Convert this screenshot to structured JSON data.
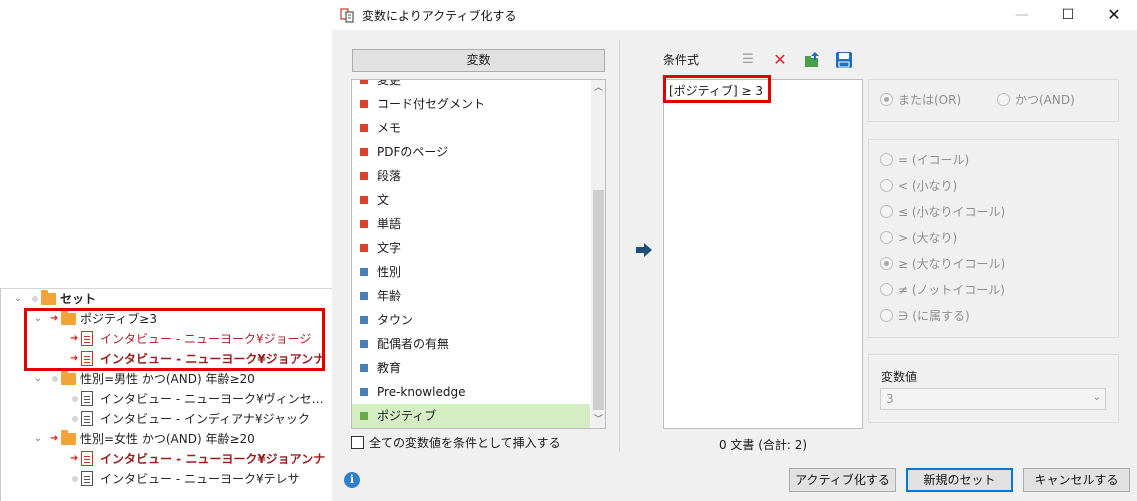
{
  "tree": {
    "root_label": "セット",
    "nodes": [
      {
        "label": "ポジティブ≥3"
      },
      {
        "label": "インタビュー - ニューヨーク¥ジョージ"
      },
      {
        "label": "インタビュー - ニューヨーク¥ジョアンナ"
      },
      {
        "label": "性別=男性 かつ(AND) 年齢≥20"
      },
      {
        "label": "インタビュー - ニューヨーク¥ヴィンセ…"
      },
      {
        "label": "インタビュー - インディアナ¥ジャック"
      },
      {
        "label": "性別=女性 かつ(AND) 年齢≥20"
      },
      {
        "label": "インタビュー - ニューヨーク¥ジョアンナ"
      },
      {
        "label": "インタビュー - ニューヨーク¥テレサ"
      }
    ]
  },
  "dialog": {
    "title": "変数によりアクティブ化する",
    "title_icon": "activate-by-variable-icon",
    "variables_header": "変数",
    "variables": [
      {
        "label": "変更",
        "color": "#d9432e"
      },
      {
        "label": "コード付セグメント",
        "color": "#d9432e"
      },
      {
        "label": "メモ",
        "color": "#d9432e"
      },
      {
        "label": "PDFのページ",
        "color": "#d9432e"
      },
      {
        "label": "段落",
        "color": "#d9432e"
      },
      {
        "label": "文",
        "color": "#d9432e"
      },
      {
        "label": "単語",
        "color": "#d9432e"
      },
      {
        "label": "文字",
        "color": "#d9432e"
      },
      {
        "label": "性別",
        "color": "#4a7fb5"
      },
      {
        "label": "年齢",
        "color": "#4a7fb5"
      },
      {
        "label": "タウン",
        "color": "#4a7fb5"
      },
      {
        "label": "配偶者の有無",
        "color": "#4a7fb5"
      },
      {
        "label": "教育",
        "color": "#4a7fb5"
      },
      {
        "label": "Pre-knowledge",
        "color": "#4a7fb5"
      },
      {
        "label": "ポジティブ",
        "color": "#6aaa4a"
      }
    ],
    "insert_all_label": "全ての変数値を条件として挿入する",
    "condition_label": "条件式",
    "condition_text": "[ポジティブ] ≥ 3",
    "doc_count": "0 文書 (合計: 2)",
    "logic": {
      "or_label": "または(OR)",
      "and_label": "かつ(AND)"
    },
    "operators": [
      {
        "label": "= (イコール)",
        "selected": false
      },
      {
        "label": "< (小なり)",
        "selected": false
      },
      {
        "label": "≤ (小なりイコール)",
        "selected": false
      },
      {
        "label": "> (大なり)",
        "selected": false
      },
      {
        "label": "≥ (大なりイコール)",
        "selected": true
      },
      {
        "label": "≠ (ノットイコール)",
        "selected": false
      },
      {
        "label": "∋ (に属する)",
        "selected": false
      }
    ],
    "value_label": "変数値",
    "value": "3",
    "buttons": {
      "activate": "アクティブ化する",
      "new_set": "新規のセット",
      "cancel": "キャンセルする"
    },
    "colors": {
      "highlight": "#e00000",
      "selected_row": "#d4edc2",
      "accent": "#0078d7"
    }
  }
}
